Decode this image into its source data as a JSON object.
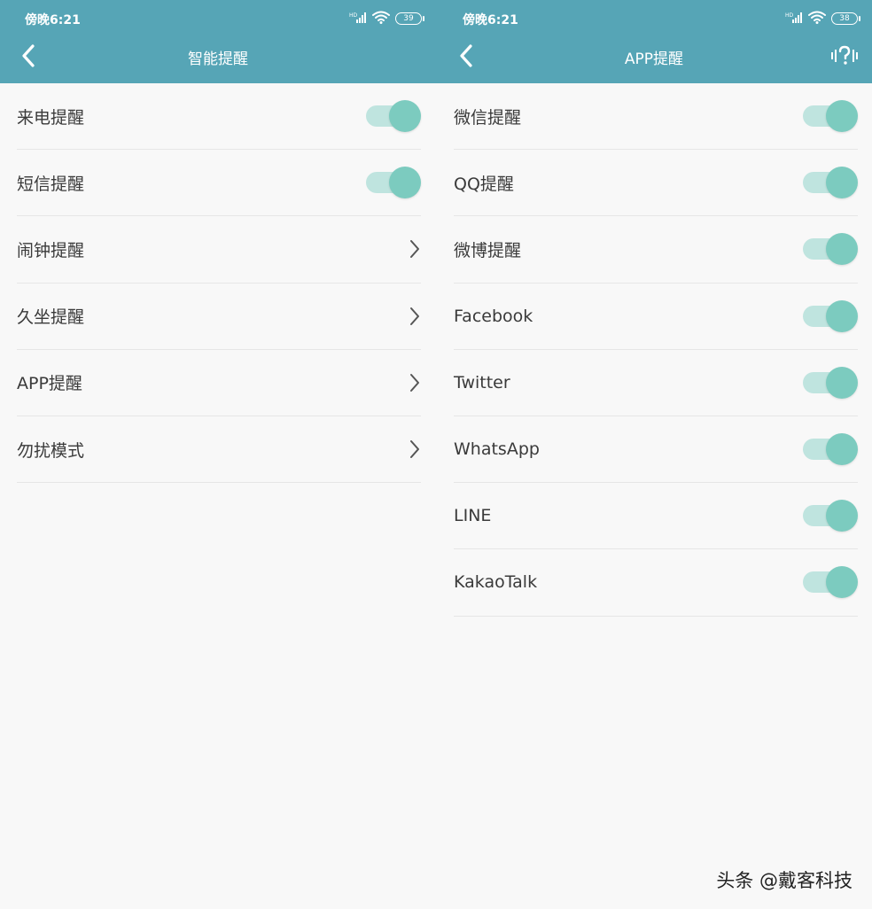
{
  "left_screen": {
    "status": {
      "time": "傍晚6:21",
      "battery": "39",
      "signal_label": "HD"
    },
    "header": {
      "title": "智能提醒",
      "back_icon": "chevron-left-icon"
    },
    "items": [
      {
        "label": "来电提醒",
        "control": "toggle",
        "on": true
      },
      {
        "label": "短信提醒",
        "control": "toggle",
        "on": true
      },
      {
        "label": "闹钟提醒",
        "control": "chevron"
      },
      {
        "label": "久坐提醒",
        "control": "chevron"
      },
      {
        "label": "APP提醒",
        "control": "chevron"
      },
      {
        "label": "勿扰模式",
        "control": "chevron"
      }
    ]
  },
  "right_screen": {
    "status": {
      "time": "傍晚6:21",
      "battery": "38",
      "signal_label": "HD"
    },
    "header": {
      "title": "APP提醒",
      "back_icon": "chevron-left-icon",
      "action_icon": "voice-help-icon"
    },
    "items": [
      {
        "label": "微信提醒",
        "control": "toggle",
        "on": true
      },
      {
        "label": "QQ提醒",
        "control": "toggle",
        "on": true
      },
      {
        "label": "微博提醒",
        "control": "toggle",
        "on": true
      },
      {
        "label": "Facebook",
        "control": "toggle",
        "on": true
      },
      {
        "label": "Twitter",
        "control": "toggle",
        "on": true
      },
      {
        "label": "WhatsApp",
        "control": "toggle",
        "on": true
      },
      {
        "label": "LINE",
        "control": "toggle",
        "on": true
      },
      {
        "label": "KakaoTalk",
        "control": "toggle",
        "on": true
      }
    ]
  },
  "watermark": "头条 @戴客科技",
  "colors": {
    "header_bg": "#56a5b6",
    "toggle_track": "#bfe4df",
    "toggle_thumb": "#7ccbbf",
    "page_bg": "#f8f8f8",
    "divider": "#e6e6e6",
    "text": "#3a3a3a"
  }
}
